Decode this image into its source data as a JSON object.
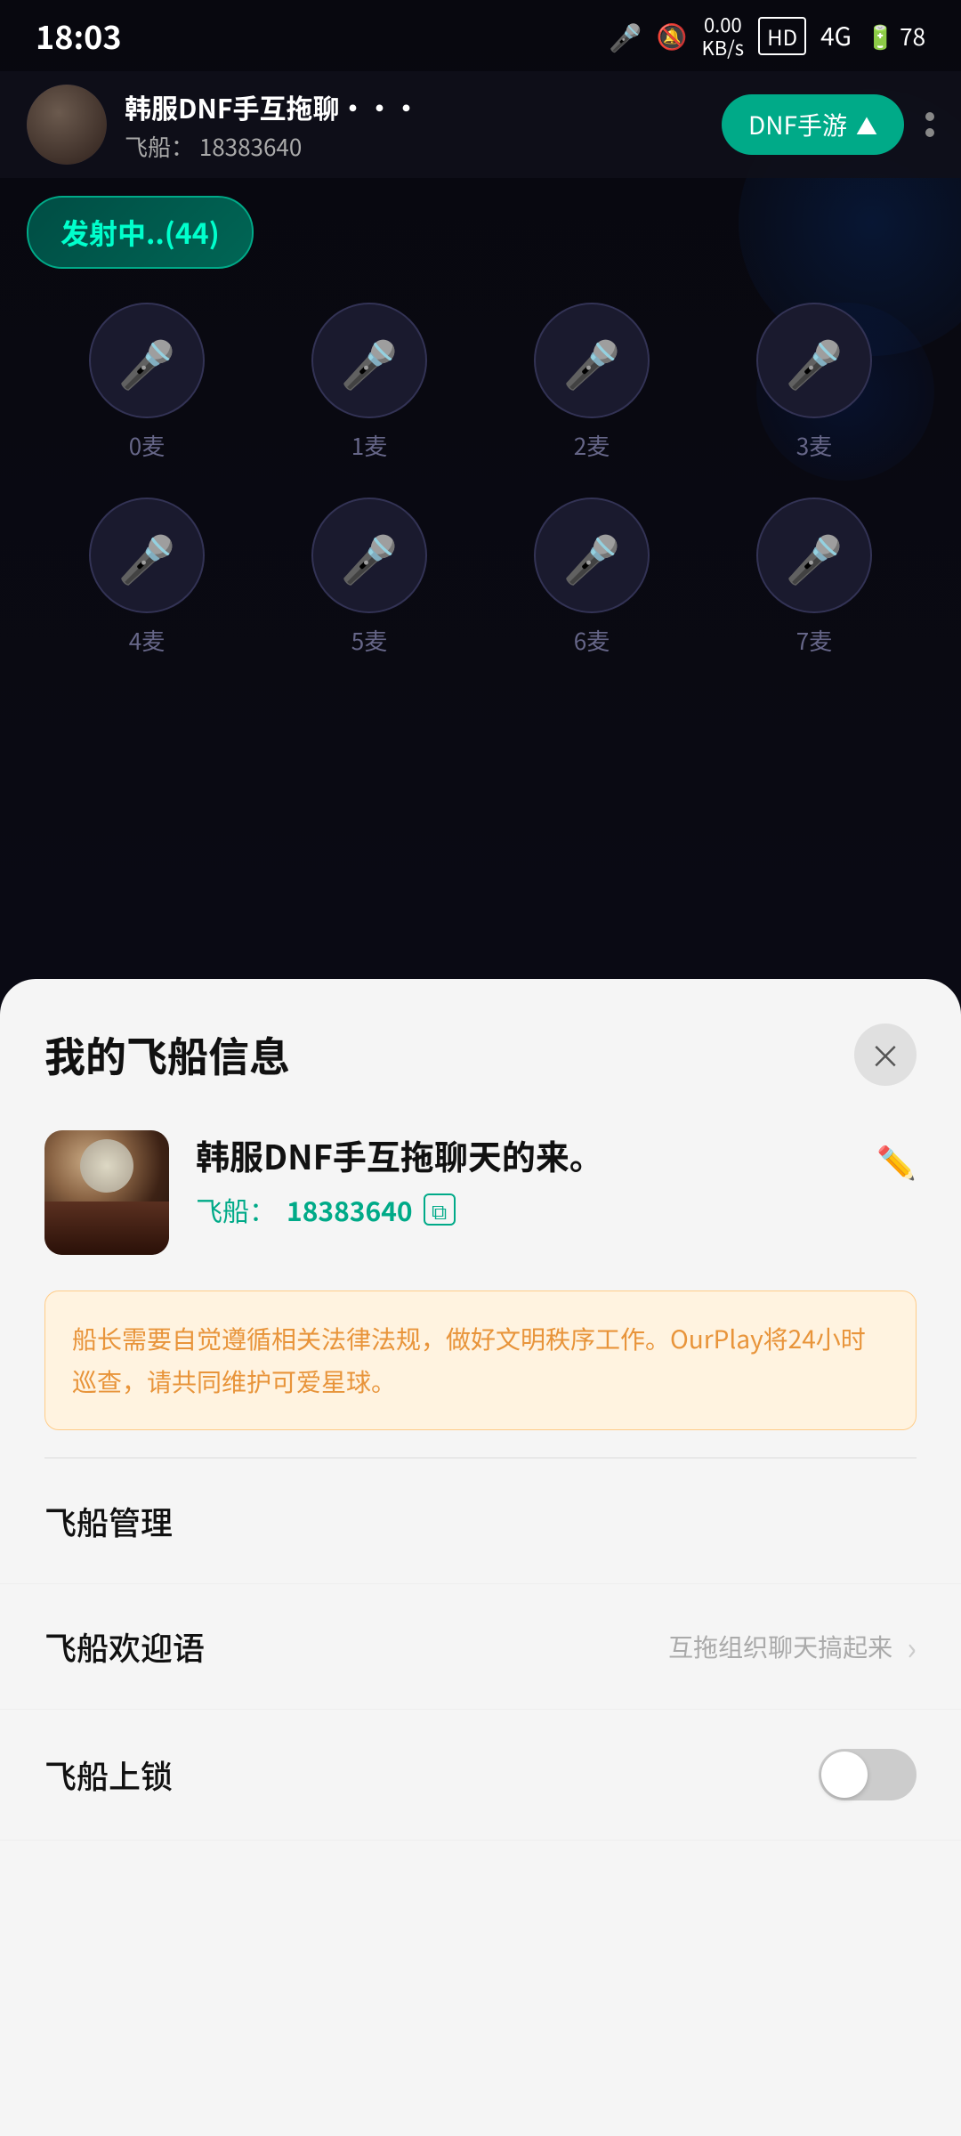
{
  "statusBar": {
    "time": "18:03",
    "icons": [
      "🎤",
      "🔕",
      "0.00\nKB/s",
      "HD",
      "4G",
      "78"
    ]
  },
  "header": {
    "avatarAlt": "user avatar",
    "name": "韩服DNF手互拖聊···",
    "sub": "飞船： 18383640",
    "btnLabel": "DNF手游",
    "moreLabel": "更多"
  },
  "broadcasting": {
    "label": "发射中..(44)"
  },
  "micGrid": {
    "row1": [
      {
        "label": "0麦"
      },
      {
        "label": "1麦"
      },
      {
        "label": "2麦"
      },
      {
        "label": "3麦"
      }
    ],
    "row2": [
      {
        "label": "4麦"
      },
      {
        "label": "5麦"
      },
      {
        "label": "6麦"
      },
      {
        "label": "7麦"
      }
    ]
  },
  "bottomSheet": {
    "title": "我的飞船信息",
    "closeLabel": "×",
    "profile": {
      "name": "韩服DNF手互拖聊天的来。",
      "idLabel": "飞船：",
      "idValue": "18383640",
      "editLabel": "编辑"
    },
    "notice": "船长需要自觉遵循相关法律法规，做好文明秩序工作。OurPlay将24小时巡查，请共同维护可爱星球。",
    "menuItems": [
      {
        "label": "飞船管理",
        "value": "",
        "hasArrow": false,
        "hasToggle": false
      },
      {
        "label": "飞船欢迎语",
        "value": "互拖组织聊天搞起来",
        "hasArrow": true,
        "hasToggle": false
      },
      {
        "label": "飞船上锁",
        "value": "",
        "hasArrow": false,
        "hasToggle": true,
        "toggleOn": false
      }
    ]
  }
}
